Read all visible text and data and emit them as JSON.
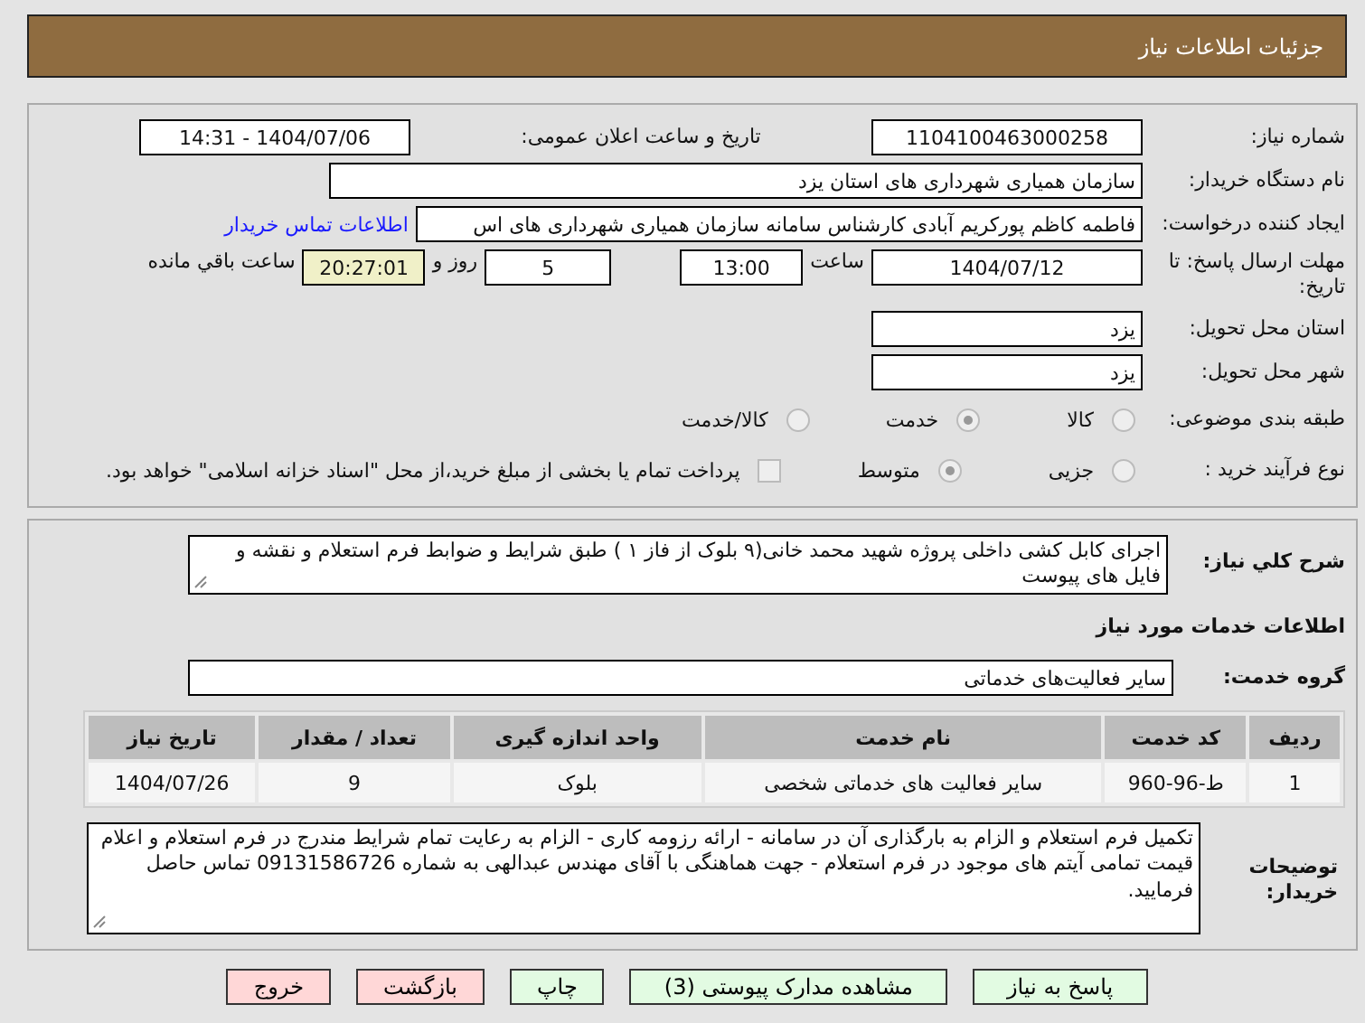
{
  "header": {
    "title": "جزئیات اطلاعات نیاز"
  },
  "need_number": {
    "label": "شماره نیاز:",
    "value": "1104100463000258"
  },
  "announce_date": {
    "label": "تاریخ و ساعت اعلان عمومی:",
    "value": "1404/07/06 - 14:31"
  },
  "buyer_org": {
    "label": "نام دستگاه خریدار:",
    "value": "سازمان همیاری شهرداری های استان یزد"
  },
  "creator": {
    "label": "ایجاد کننده درخواست:",
    "value": "فاطمه کاظم پورکریم آبادی کارشناس سامانه سازمان همیاری شهرداری های اس",
    "link": "اطلاعات تماس خریدار"
  },
  "deadline": {
    "label": "مهلت ارسال پاسخ: تا تاریخ:",
    "date": "1404/07/12",
    "time_label": "ساعت",
    "time": "13:00",
    "days": "5",
    "days_label": "روز و",
    "remaining": "20:27:01",
    "remaining_label": "ساعت باقي مانده"
  },
  "province": {
    "label": "استان محل تحویل:",
    "value": "یزد"
  },
  "city": {
    "label": "شهر محل تحویل:",
    "value": "یزد"
  },
  "category": {
    "label": "طبقه بندی موضوعی:",
    "options": [
      {
        "label": "کالا",
        "selected": false
      },
      {
        "label": "خدمت",
        "selected": true
      },
      {
        "label": "کالا/خدمت",
        "selected": false
      }
    ]
  },
  "process": {
    "label": "نوع فرآیند خرید :",
    "options": [
      {
        "label": "جزیی",
        "selected": false
      },
      {
        "label": "متوسط",
        "selected": true
      }
    ],
    "treasury": {
      "label": "پرداخت تمام یا بخشی از مبلغ خرید،از محل \"اسناد خزانه اسلامی\" خواهد بود.",
      "checked": false
    }
  },
  "summary": {
    "label": "شرح کلي نیاز:",
    "value": "اجرای کابل کشی داخلی پروژه شهید محمد خانی(۹ بلوک از فاز ۱ ) طبق شرایط و ضوابط فرم استعلام و نقشه و فایل های پیوست"
  },
  "services_title": "اطلاعات خدمات مورد نیاز",
  "service_group": {
    "label": "گروه خدمت:",
    "value": "سایر فعالیت‌های خدماتی"
  },
  "table": {
    "columns": [
      "ردیف",
      "کد خدمت",
      "نام خدمت",
      "واحد اندازه گیری",
      "تعداد / مقدار",
      "تاریخ نیاز"
    ],
    "rows": [
      [
        "1",
        "ط-96-960",
        "سایر فعالیت های خدماتی شخصی",
        "بلوک",
        "9",
        "1404/07/26"
      ]
    ]
  },
  "buyer_notes": {
    "label": "توضیحات خریدار:",
    "value": "تکمیل فرم استعلام و الزام به بارگذاری آن در سامانه - ارائه رزومه کاری - الزام به رعایت تمام شرایط مندرج در فرم استعلام و اعلام قیمت تمامی آیتم های موجود در فرم استعلام - جهت هماهنگی با آقای مهندس عبدالهی به شماره 09131586726 تماس حاصل فرمایید."
  },
  "buttons": [
    {
      "label": "پاسخ به نیاز",
      "kind": "green"
    },
    {
      "label": "مشاهده مدارک پیوستی (3)",
      "kind": "green"
    },
    {
      "label": "چاپ",
      "kind": "green"
    },
    {
      "label": "بازگشت",
      "kind": "red"
    },
    {
      "label": "خروج",
      "kind": "red"
    }
  ]
}
